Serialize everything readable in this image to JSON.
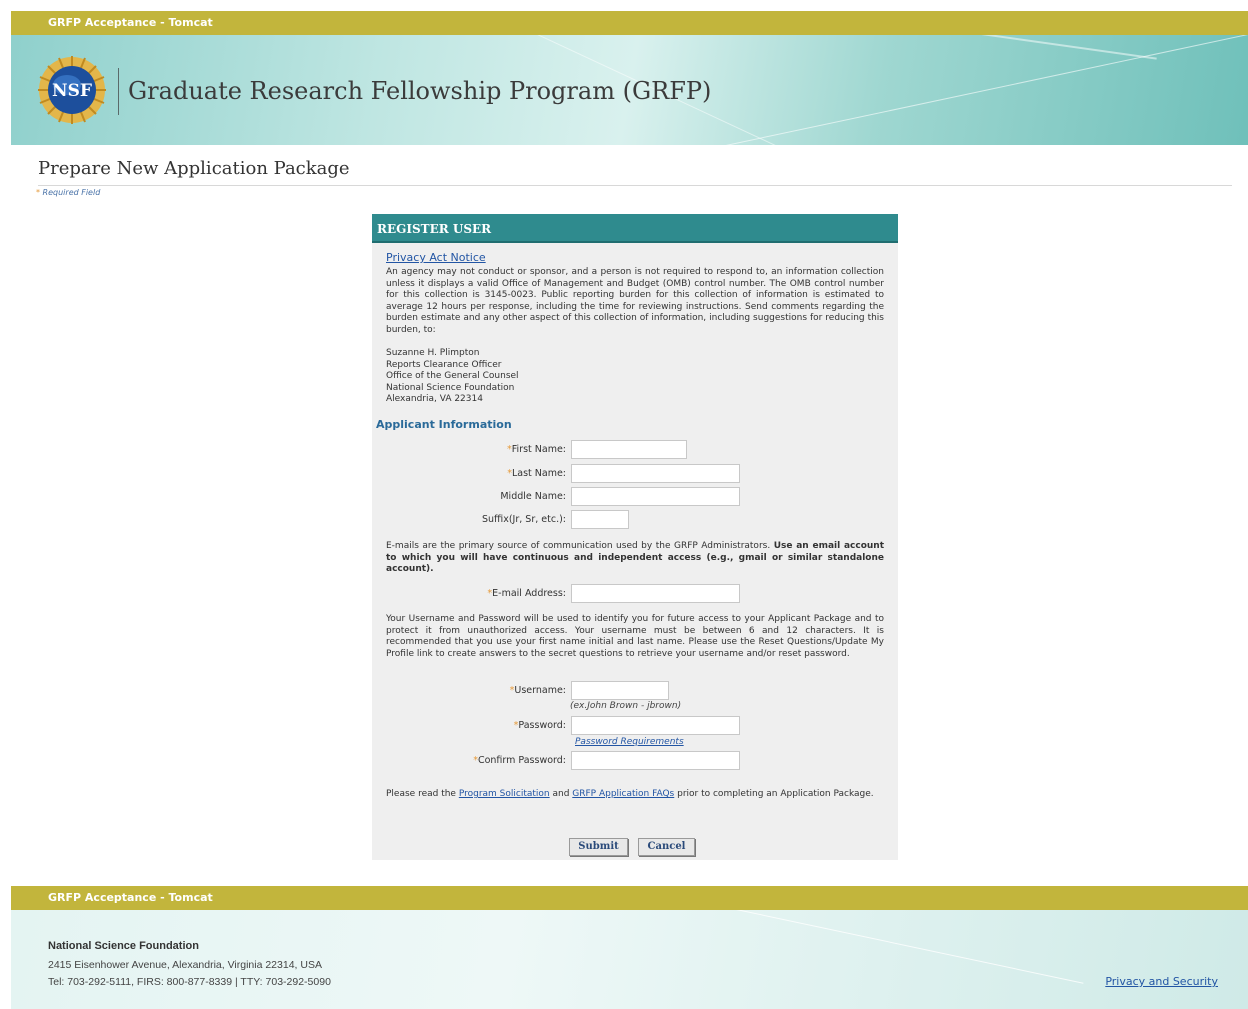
{
  "environment_label": "GRFP Acceptance - Tomcat",
  "site": {
    "title": "Graduate Research Fellowship Program (GRFP)",
    "logo_text": "NSF"
  },
  "page": {
    "title": "Prepare New Application Package",
    "required_note": "Required Field"
  },
  "panel": {
    "header": "REGISTER USER",
    "privacy_link": "Privacy Act Notice",
    "privacy_text": "An agency may not conduct or sponsor, and a person is not required to respond to, an information collection unless it displays a valid Office of Management and Budget (OMB) control number. The OMB control number for this collection is 3145-0023. Public reporting burden for this collection of information is estimated to average 12 hours per response, including the time for reviewing instructions. Send comments regarding the burden estimate and any other aspect of this collection of information, including suggestions for reducing this burden, to:",
    "address_lines": [
      "Suzanne H. Plimpton",
      "Reports Clearance Officer",
      "Office of the General Counsel",
      "National Science Foundation",
      "Alexandria, VA 22314"
    ],
    "section_title": "Applicant Information",
    "fields": {
      "first_name": {
        "label": "First Name:",
        "value": ""
      },
      "last_name": {
        "label": "Last Name:",
        "value": ""
      },
      "middle_name": {
        "label": "Middle Name:",
        "value": ""
      },
      "suffix": {
        "label": "Suffix(Jr, Sr, etc.):",
        "value": ""
      },
      "email": {
        "label": "E-mail Address:",
        "value": ""
      },
      "username": {
        "label": "Username:",
        "value": ""
      },
      "password": {
        "label": "Password:",
        "value": ""
      },
      "confirm_password": {
        "label": "Confirm Password:",
        "value": ""
      }
    },
    "email_para_plain": "E-mails are the primary source of communication used by the GRFP Administrators. ",
    "email_para_bold": "Use an email account to which you will have continuous and independent access (e.g., gmail or similar standalone account).",
    "username_para": "Your Username and Password will be used to identify you for future access to your Applicant Package and to protect it from unauthorized access. Your username must be between 6 and 12 characters. It is recommended that you use your first name initial and last name. Please use the Reset Questions/Update My Profile link to create answers to the secret questions to retrieve your username and/or reset password.",
    "username_hint": "(ex.John Brown - jbrown)",
    "password_link": "Password Requirements",
    "read_para_prefix": "Please read the ",
    "read_link1": "Program Solicitation",
    "read_para_mid": " and ",
    "read_link2": "GRFP Application FAQs",
    "read_para_suffix": " prior to completing an Application Package.",
    "submit_label": "Submit",
    "cancel_label": "Cancel"
  },
  "footer": {
    "environment_label": "GRFP Acceptance - Tomcat",
    "org": "National Science Foundation",
    "address": "2415 Eisenhower Avenue, Alexandria, Virginia 22314, USA",
    "tel": "Tel: 703-292-5111, FIRS: 800-877-8339 | TTY: 703-292-5090",
    "privacy_link": "Privacy and Security"
  },
  "colors": {
    "env_bar": "#c2b53c",
    "panel_header": "#2f8b8e",
    "link": "#2255a4",
    "required_star": "#e59a3a"
  }
}
